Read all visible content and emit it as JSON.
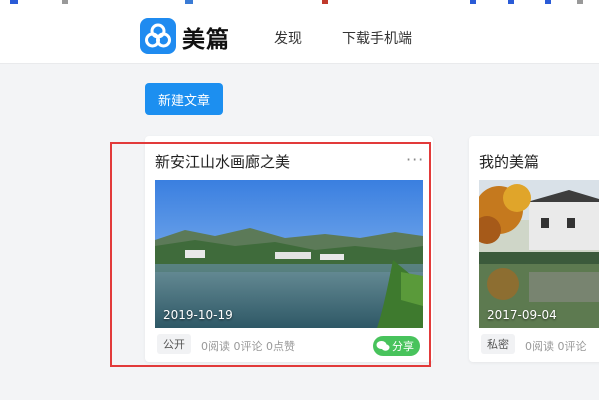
{
  "brand": {
    "name": "美篇"
  },
  "nav": {
    "discover": "发现",
    "download": "下载手机端"
  },
  "actions": {
    "new_article": "新建文章"
  },
  "cards": [
    {
      "title": "新安江山水画廊之美",
      "more": "···",
      "date": "2019-10-19",
      "visibility": "公开",
      "stats": "0阅读 0评论 0点赞",
      "share": "分享"
    },
    {
      "title": "我的美篇",
      "date": "2017-09-04",
      "visibility": "私密",
      "stats": "0阅读 0评论"
    }
  ],
  "colors": {
    "accent": "#1c8ff0",
    "share": "#48c35c",
    "highlight": "#e23a3a"
  }
}
